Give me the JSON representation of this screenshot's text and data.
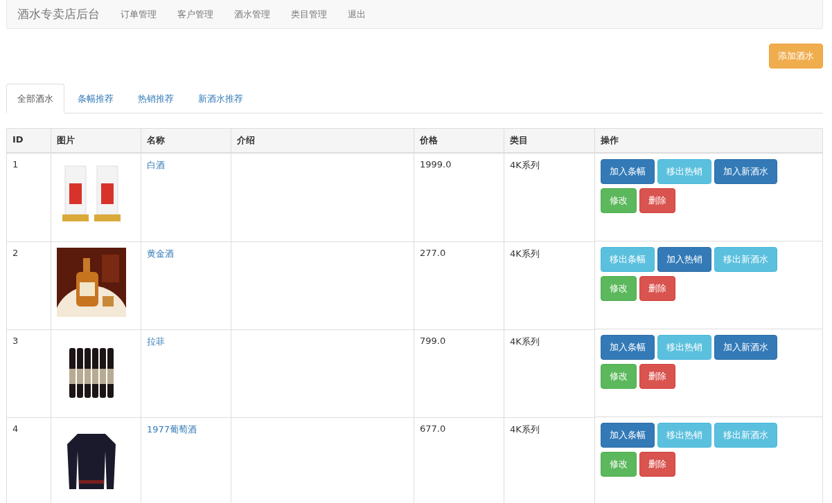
{
  "navbar": {
    "brand": "酒水专卖店后台",
    "links": [
      "订单管理",
      "客户管理",
      "酒水管理",
      "类目管理",
      "退出"
    ]
  },
  "add_button": "添加酒水",
  "tabs": [
    {
      "label": "全部酒水",
      "selected": true
    },
    {
      "label": "条幅推荐",
      "selected": false
    },
    {
      "label": "热销推荐",
      "selected": false
    },
    {
      "label": "新酒水推荐",
      "selected": false
    }
  ],
  "table": {
    "columns": [
      "ID",
      "图片",
      "名称",
      "介绍",
      "价格",
      "类目",
      "操作"
    ],
    "rows": [
      {
        "id": "1",
        "name": "白酒",
        "price": "1999.0",
        "category": "4K系列",
        "actions": [
          {
            "label": "加入条幅",
            "kind": "primary"
          },
          {
            "label": "移出热销",
            "kind": "info"
          },
          {
            "label": "加入新酒水",
            "kind": "primary"
          },
          {
            "label": "修改",
            "kind": "success"
          },
          {
            "label": "删除",
            "kind": "danger"
          }
        ]
      },
      {
        "id": "2",
        "name": "黄金酒",
        "price": "277.0",
        "category": "4K系列",
        "actions": [
          {
            "label": "移出条幅",
            "kind": "info"
          },
          {
            "label": "加入热销",
            "kind": "primary"
          },
          {
            "label": "移出新酒水",
            "kind": "info"
          },
          {
            "label": "修改",
            "kind": "success"
          },
          {
            "label": "删除",
            "kind": "danger"
          }
        ]
      },
      {
        "id": "3",
        "name": "拉菲",
        "price": "799.0",
        "category": "4K系列",
        "actions": [
          {
            "label": "加入条幅",
            "kind": "primary"
          },
          {
            "label": "移出热销",
            "kind": "info"
          },
          {
            "label": "加入新酒水",
            "kind": "primary"
          },
          {
            "label": "修改",
            "kind": "success"
          },
          {
            "label": "删除",
            "kind": "danger"
          }
        ]
      },
      {
        "id": "4",
        "name": "1977葡萄酒",
        "price": "677.0",
        "category": "4K系列",
        "actions": [
          {
            "label": "加入条幅",
            "kind": "primary"
          },
          {
            "label": "移出热销",
            "kind": "info"
          },
          {
            "label": "移出新酒水",
            "kind": "info"
          },
          {
            "label": "修改",
            "kind": "success"
          },
          {
            "label": "删除",
            "kind": "danger"
          }
        ]
      }
    ]
  }
}
